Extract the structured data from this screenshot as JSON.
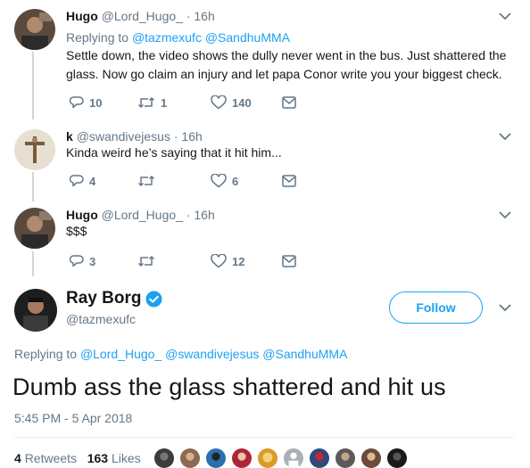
{
  "replies": [
    {
      "name": "Hugo",
      "handle": "@Lord_Hugo_",
      "dot": "·",
      "time": "16h",
      "replying_prefix": "Replying to",
      "replying_to": [
        "@tazmexufc",
        "@SandhuMMA"
      ],
      "text_lines": [
        "Settle down, the video shows the dully never went in the bus. Just shattered the",
        "glass. Now go claim an injury and let papa Conor write you your biggest check."
      ],
      "reply_count": "10",
      "retweet_count": "1",
      "like_count": "140"
    },
    {
      "name": "k",
      "handle": "@swandivejesus",
      "dot": "·",
      "time": "16h",
      "text_lines": [
        "Kinda weird he’s saying that it hit him..."
      ],
      "reply_count": "4",
      "retweet_count": "",
      "like_count": "6"
    },
    {
      "name": "Hugo",
      "handle": "@Lord_Hugo_",
      "dot": "·",
      "time": "16h",
      "text_lines": [
        "$$$"
      ],
      "reply_count": "3",
      "retweet_count": "",
      "like_count": "12"
    }
  ],
  "main_tweet": {
    "name": "Ray Borg",
    "handle": "@tazmexufc",
    "follow_label": "Follow",
    "replying_prefix": "Replying to",
    "replying_to": [
      "@Lord_Hugo_",
      "@swandivejesus",
      "@SandhuMMA"
    ],
    "text": "Dumb ass the glass shattered and hit us",
    "timestamp": "5:45 PM - 5 Apr 2018",
    "retweets_count": "4",
    "retweets_label": "Retweets",
    "likes_count": "163",
    "likes_label": "Likes"
  },
  "colors": {
    "link": "#1da1f2",
    "secondary_text": "#657786",
    "thread_line": "#ccd6dd",
    "primary_text": "#14171a"
  },
  "icons": [
    "chevron-down-icon",
    "reply-icon",
    "retweet-icon",
    "like-icon",
    "dm-icon",
    "verified-icon"
  ]
}
